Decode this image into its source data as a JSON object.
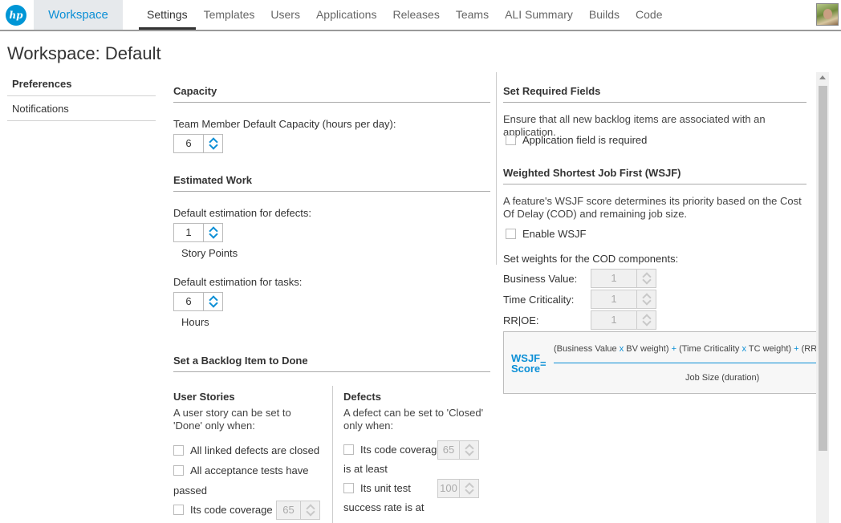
{
  "topnav": {
    "logo_text": "hp",
    "workspace_tab": "Workspace",
    "items": [
      "Settings",
      "Templates",
      "Users",
      "Applications",
      "Releases",
      "Teams",
      "ALI Summary",
      "Builds",
      "Code"
    ],
    "active_item": "Settings"
  },
  "page": {
    "title": "Workspace: Default"
  },
  "leftnav": {
    "items": [
      "Preferences",
      "Notifications"
    ],
    "active_item": "Preferences"
  },
  "capacity": {
    "title": "Capacity",
    "label": "Team Member Default Capacity (hours per day):",
    "value": "6"
  },
  "estimated_work": {
    "title": "Estimated Work",
    "defects_label": "Default estimation for defects:",
    "defects_value": "1",
    "defects_unit": "Story Points",
    "tasks_label": "Default estimation for tasks:",
    "tasks_value": "6",
    "tasks_unit": "Hours"
  },
  "done": {
    "title": "Set a Backlog Item to Done",
    "user_stories": {
      "title": "User Stories",
      "desc": "A user story can be set to 'Done' only when:",
      "opt1": "All linked defects are closed",
      "opt2": "All acceptance tests have",
      "opt2_cont": "passed",
      "opt3": "Its code coverage is",
      "opt3_value": "65"
    },
    "defects": {
      "title": "Defects",
      "desc": "A defect can be set to 'Closed' only when:",
      "opt1": "Its code coverage",
      "opt1_value": "65",
      "opt1_cont": "is at least",
      "opt2": "Its unit test",
      "opt2_value": "100",
      "opt2_cont": "success rate is at"
    }
  },
  "required_fields": {
    "title": "Set Required Fields",
    "desc": "Ensure that all new backlog items are associated with an application.",
    "checkbox_label": "Application field is required"
  },
  "wsjf": {
    "title": "Weighted Shortest Job First (WSJF)",
    "desc": "A feature's WSJF score determines its priority based on the Cost Of Delay (COD) and remaining job size.",
    "enable_label": "Enable WSJF",
    "weights_label": "Set weights for the COD components:",
    "business_value_label": "Business Value:",
    "business_value": "1",
    "time_criticality_label": "Time Criticality:",
    "time_criticality": "1",
    "rroe_label": "RR|OE:",
    "rroe": "1",
    "formula": {
      "lhs_line1": "WSJF",
      "lhs_line2": "Score",
      "equals": "=",
      "bv": "(Business Value",
      "bv_weight": "BV weight)",
      "tc": "(Time Criticality",
      "tc_weight": "TC weight)",
      "rr": "(RR|O",
      "times": "x",
      "plus": "+",
      "denominator": "Job Size (duration)"
    }
  },
  "colors": {
    "accent": "#0b8fd6",
    "workspace_tab_bg": "#e6e9ec",
    "formula_bg": "#f7f7f7"
  }
}
